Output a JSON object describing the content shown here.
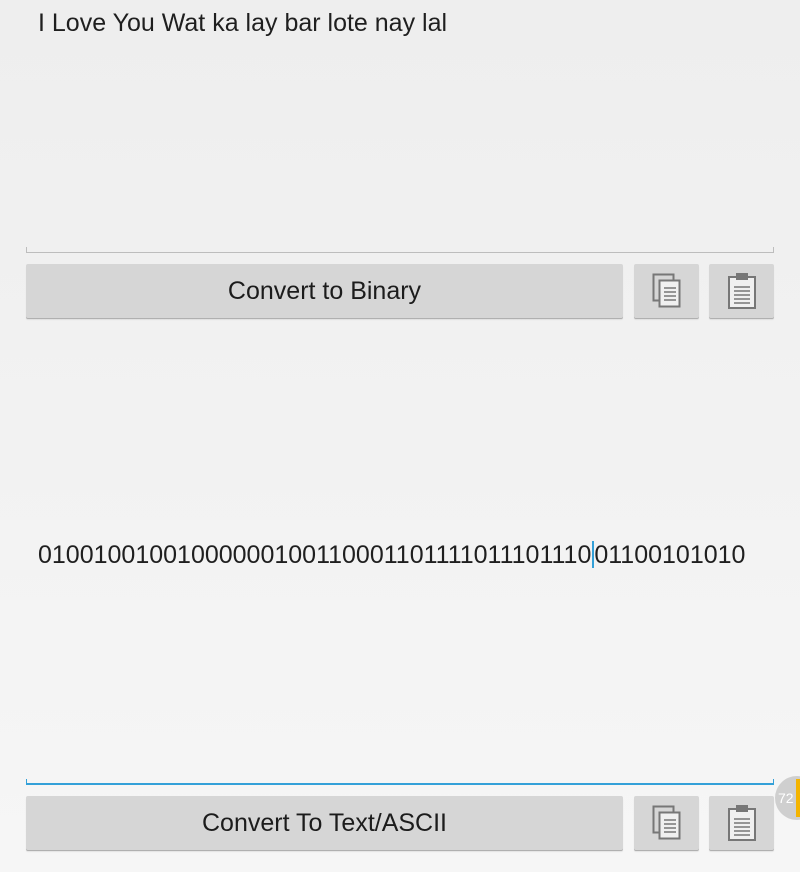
{
  "input_text": {
    "value": "I Love You Wat ka lay bar lote nay lal"
  },
  "convert_to_binary_button": {
    "label": "Convert to Binary"
  },
  "binary_output": {
    "value_before_caret": "01001001001000000100110001101111011101110",
    "value_after_caret": "01100101010"
  },
  "convert_to_text_button": {
    "label": "Convert To Text/ASCII"
  },
  "icons": {
    "copy": "copy-icon",
    "paste": "paste-icon"
  },
  "badge": {
    "text": "72"
  },
  "colors": {
    "accent": "#33a0d8",
    "button": "#d6d6d6",
    "background": "#eeeeee",
    "badge_accent": "#f4b400"
  }
}
